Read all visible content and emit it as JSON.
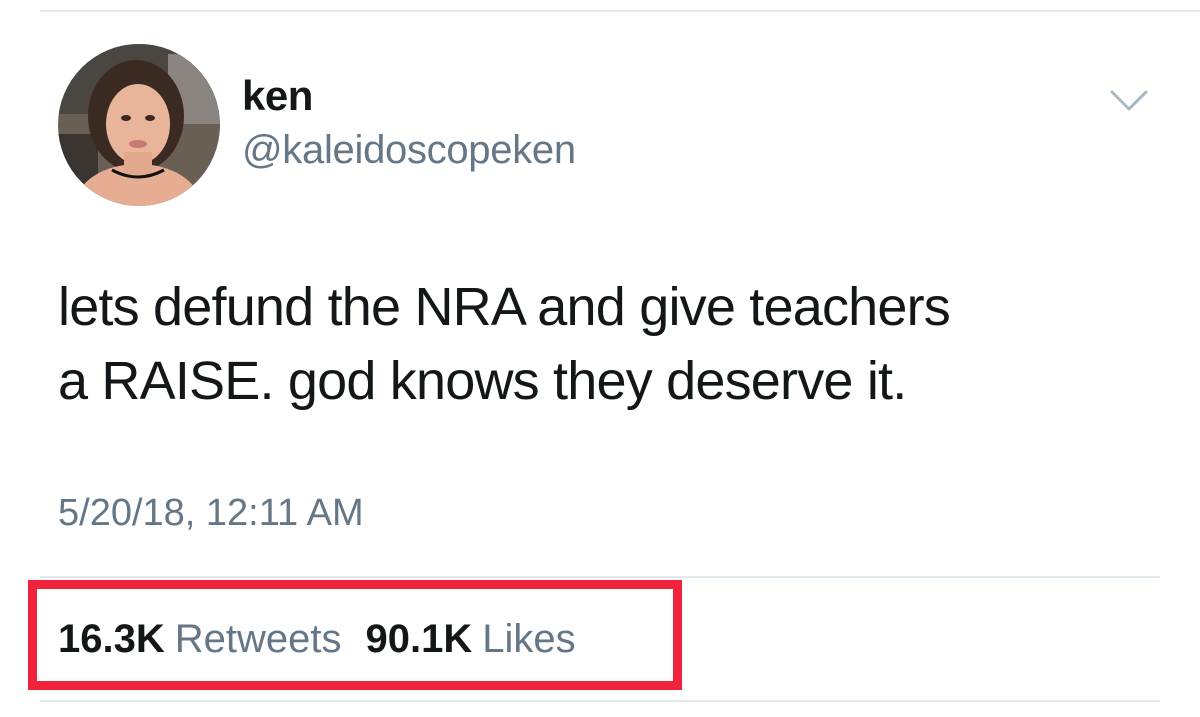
{
  "user": {
    "display_name": "ken",
    "handle": "@kaleidoscopeken",
    "avatar": "profile-photo"
  },
  "tweet": {
    "text_lines": [
      "lets defund the NRA and give teachers",
      "a RAISE. god knows they deserve it."
    ],
    "timestamp": "5/20/18, 12:11 AM"
  },
  "stats": {
    "retweets_count": "16.3K",
    "retweets_label": "Retweets",
    "likes_count": "90.1K",
    "likes_label": "Likes"
  },
  "icons": {
    "menu": "chevron-down-icon"
  },
  "colors": {
    "text_primary": "#14171a",
    "text_secondary": "#657786",
    "divider": "#e1e8ed",
    "highlight": "#f0223c"
  }
}
